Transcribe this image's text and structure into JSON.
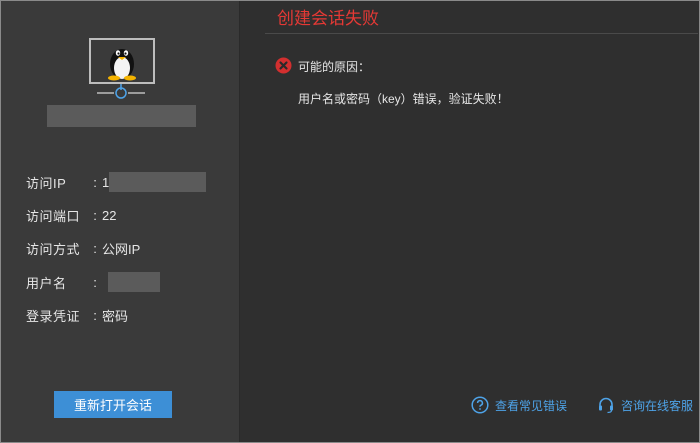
{
  "sidebar": {
    "info": [
      {
        "label": "访问IP",
        "value": "1"
      },
      {
        "label": "访问端口",
        "value": "22"
      },
      {
        "label": "访问方式",
        "value": "公网IP"
      },
      {
        "label": "用户名",
        "value": ""
      },
      {
        "label": "登录凭证",
        "value": "密码"
      }
    ],
    "separator": ":",
    "reopen_label": "重新打开会话"
  },
  "main": {
    "title": "创建会话失败",
    "reason_label": "可能的原因：",
    "reason_text": "用户名或密码（key）错误，验证失败！"
  },
  "footer": {
    "faq_label": "查看常见错误",
    "support_label": "咨询在线客服"
  },
  "colors": {
    "accent": "#3d8fd6",
    "error": "#e53935",
    "link": "#4ea3e8"
  },
  "icons": [
    "linux-penguin-icon",
    "network-icon",
    "error-icon",
    "help-circle-icon",
    "headset-icon"
  ]
}
